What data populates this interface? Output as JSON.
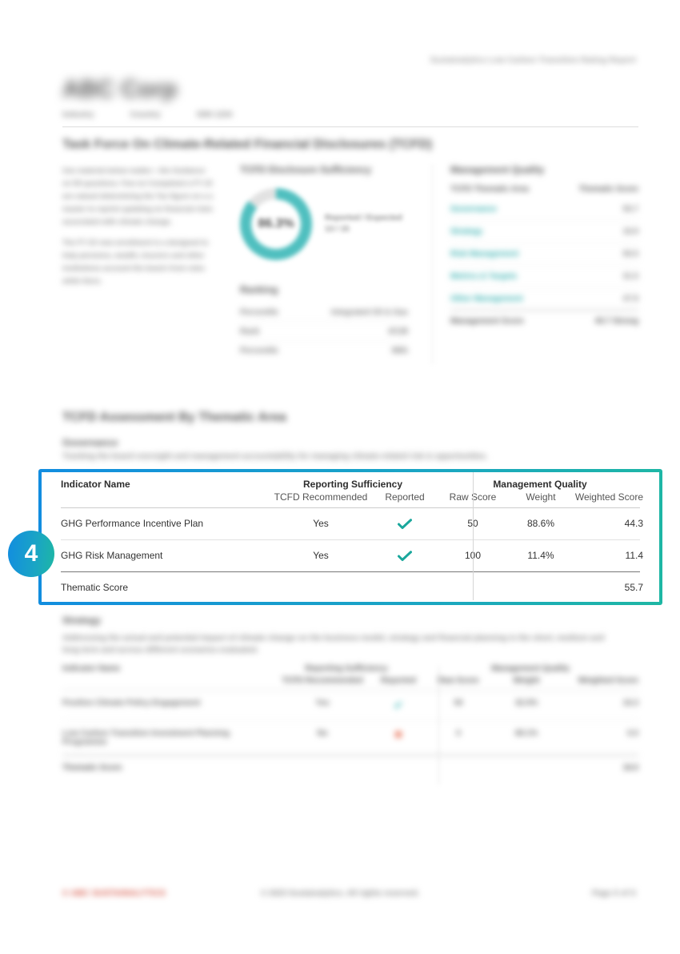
{
  "headerRight": "Sustainalytics Low Carbon Transition Rating Report",
  "company": "ABC Corp",
  "meta": {
    "a": "Industry",
    "b": "Country",
    "c": "ISIN 1234"
  },
  "section1Title": "Task Force On Climate-Related Financial Disclosures (TCFD)",
  "leftParas": [
    "Use material below matter––the Guidance on 59 questions. Few on Completed a FY 23 are valued determining the Tax figure on a a master to reprint updating on financial risks associated with climate change.",
    "The FY 2X new enrollment is a designed to help pensions, wealth, insurers and other institutions account the board–from rules while there."
  ],
  "midTitle": "TCFD Disclosure Sufficiency",
  "donutPct": "86.3%",
  "donutLabel1": "Reported / Expected",
  "donutLabel2": "13 / 15",
  "rankingTitle": "Ranking",
  "rankingRows": [
    {
      "l": "Percentile",
      "r": "Integrated Oil & Gas"
    },
    {
      "l": "Rank",
      "r": "4/138"
    },
    {
      "l": "Percentile",
      "r": "98th"
    }
  ],
  "rightTitle": "Management Quality",
  "mqHeader": {
    "a": "TCFD Thematic Area",
    "b": "Thematic Score"
  },
  "mqRows": [
    {
      "label": "Governance",
      "val": "55.7"
    },
    {
      "label": "Strategy",
      "val": "16.9"
    },
    {
      "label": "Risk Management",
      "val": "50.5"
    },
    {
      "label": "Metrics & Targets",
      "val": "31.5"
    },
    {
      "label": "Other Management",
      "val": "47.9"
    }
  ],
  "mqTotal": {
    "label": "Management Score",
    "val": "40.7   Strong"
  },
  "section2Title": "TCFD Assessment By Thematic Area",
  "govLabel": "Governance",
  "govDesc": "Tracking the board oversight and management accountability for managing climate-related risk & opportunities.",
  "callout": "4",
  "focusTable": {
    "h1": "Indicator Name",
    "hRS": "Reporting Sufficiency",
    "hMQ": "Management Quality",
    "s2": "TCFD Recommended",
    "s3": "Reported",
    "s4": "Raw Score",
    "s5": "Weight",
    "s6": "Weighted Score",
    "rows": [
      {
        "name": "GHG Performance Incentive Plan",
        "rec": "Yes",
        "raw": "50",
        "weight": "88.6%",
        "ws": "44.3"
      },
      {
        "name": "GHG Risk Management",
        "rec": "Yes",
        "raw": "100",
        "weight": "11.4%",
        "ws": "11.4"
      }
    ],
    "footerLabel": "Thematic Score",
    "footerVal": "55.7"
  },
  "strategyLabel": "Strategy",
  "strategyDesc": "Addressing the actual and potential impact of climate change on the business model, strategy and financial planning in the short, medium and long term and across different scenarios evaluated.",
  "strategyTable": {
    "h1": "Indicator Name",
    "hRS": "Reporting Sufficiency",
    "hMQ": "Management Quality",
    "s2": "TCFD Recommended",
    "s3": "Reported",
    "s4": "Raw Score",
    "s5": "Weight",
    "s6": "Weighted Score",
    "rows": [
      {
        "name": "Positive Climate Policy Engagement",
        "rec": "Yes",
        "reported": "check",
        "raw": "50",
        "weight": "32.0%",
        "ws": "16.3"
      },
      {
        "name": "Low Carbon Transition Investment Planning Programme",
        "rec": "No",
        "reported": "cross",
        "raw": "0",
        "weight": "68.1%",
        "ws": "0.0"
      }
    ],
    "footerLabel": "Thematic Score",
    "footerVal": "16.0"
  },
  "footerLeft": "© ABC SUSTAINALYTICS",
  "footerCenter": "© 2023 Sustainalytics. All rights reserved.",
  "footerRight": "Page X of X"
}
